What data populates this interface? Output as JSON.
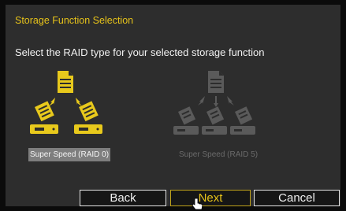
{
  "window": {
    "title": "Storage Function Selection",
    "instruction": "Select the RAID type for your selected storage function"
  },
  "options": [
    {
      "label": "Super Speed (RAID 0)",
      "selected": true,
      "icon": "raid0-diagram-icon",
      "color": "#e8c91c"
    },
    {
      "label": "Super Speed (RAID 5)",
      "selected": false,
      "icon": "raid5-diagram-icon",
      "color": "#5a5a5a"
    }
  ],
  "buttons": {
    "back": "Back",
    "next": "Next",
    "cancel": "Cancel"
  },
  "colors": {
    "accent": "#e6c21a",
    "panel": "#2d2d2d",
    "background": "#0b0b0b"
  }
}
